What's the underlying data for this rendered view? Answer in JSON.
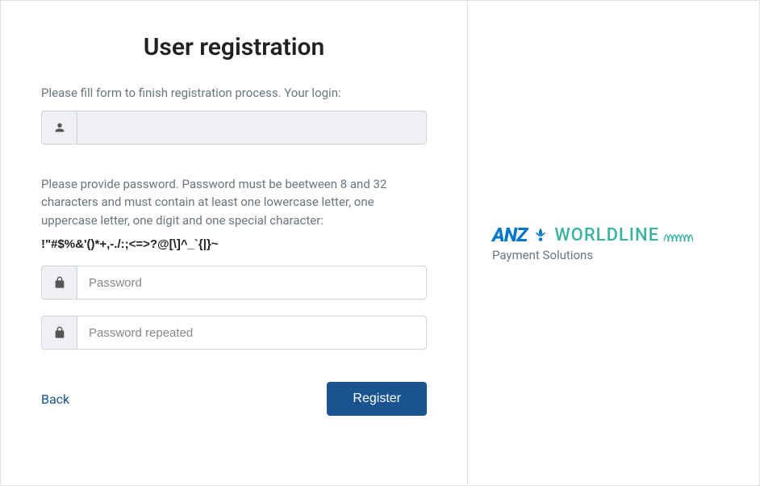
{
  "form": {
    "title": "User registration",
    "login_instruction": "Please fill form to finish registration process. Your login:",
    "login_value": "",
    "password_instruction": "Please provide password. Password must be beetween 8 and 32 characters and must contain at least one lowercase letter, one uppercase letter, one digit and one special character:",
    "special_chars": "!\"#$%&'()*+,-./:;<=>?@[\\]^_`{|}~",
    "password_placeholder": "Password",
    "password_repeated_placeholder": "Password repeated",
    "back_label": "Back",
    "register_label": "Register"
  },
  "brand": {
    "anz": "ANZ",
    "worldline": "WORLDLINE",
    "tagline": "Payment Solutions"
  }
}
